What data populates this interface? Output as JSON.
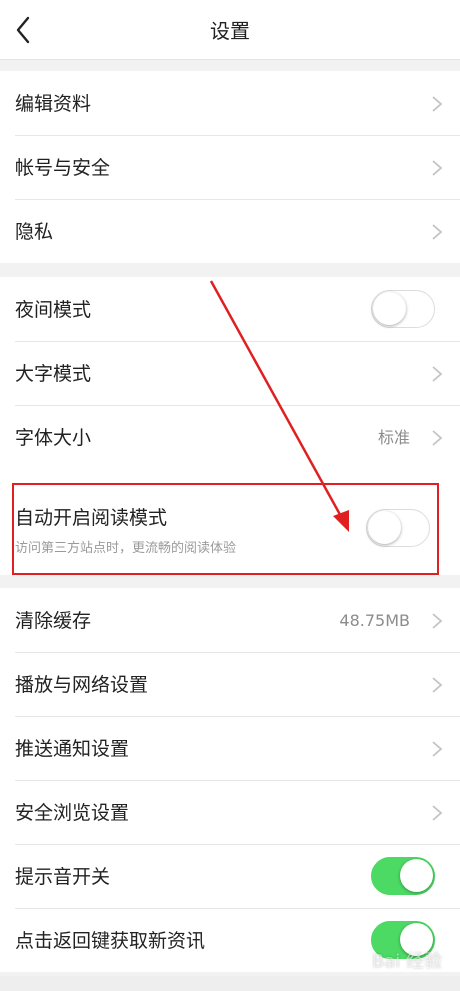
{
  "header": {
    "title": "设置"
  },
  "group1": {
    "items": [
      {
        "label": "编辑资料"
      },
      {
        "label": "帐号与安全"
      },
      {
        "label": "隐私"
      }
    ]
  },
  "group2": {
    "night_mode": {
      "label": "夜间模式",
      "on": false
    },
    "large_font": {
      "label": "大字模式"
    },
    "font_size": {
      "label": "字体大小",
      "value": "标准"
    }
  },
  "reading_mode": {
    "title": "自动开启阅读模式",
    "subtitle": "访问第三方站点时，更流畅的阅读体验",
    "on": false
  },
  "group3": {
    "clear_cache": {
      "label": "清除缓存",
      "value": "48.75MB"
    },
    "items": [
      {
        "label": "播放与网络设置"
      },
      {
        "label": "推送通知设置"
      },
      {
        "label": "安全浏览设置"
      }
    ],
    "sound": {
      "label": "提示音开关",
      "on": true
    },
    "back_refresh": {
      "label": "点击返回键获取新资讯",
      "on": true
    }
  },
  "watermark": "Bai 经验",
  "colors": {
    "toggle_on": "#4cd964",
    "annotation": "#e02020"
  }
}
